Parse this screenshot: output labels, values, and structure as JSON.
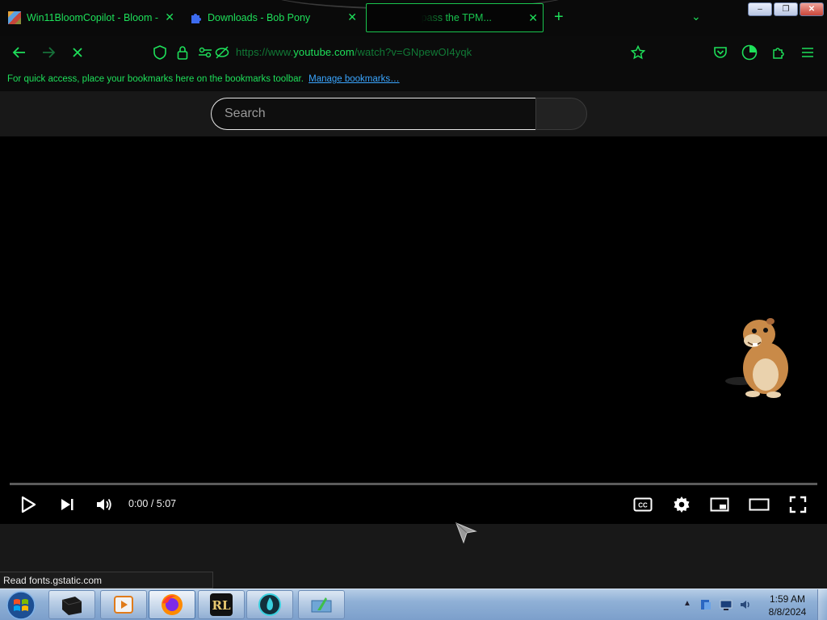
{
  "tabs": [
    {
      "title": "Win11BloomCopilot - Bloom -",
      "favicon": "bloom-favicon"
    },
    {
      "title": "Downloads - Bob Pony",
      "favicon": "puzzle-favicon"
    },
    {
      "title": "How to bypass the TPM...",
      "favicon": "youtube-favicon",
      "active": true
    }
  ],
  "window_controls": {
    "minimize": "‒",
    "restore": "❐",
    "close": "✕"
  },
  "url": {
    "scheme": "https://www.",
    "host": "youtube.com",
    "path": "/watch?v=GNpewOI4yqk"
  },
  "bookmarks_bar": {
    "message": "For quick access, place your bookmarks here on the bookmarks toolbar.",
    "link": "Manage bookmarks…"
  },
  "youtube": {
    "search_placeholder": "Search"
  },
  "player": {
    "current_time": "0:00",
    "duration": "5:07",
    "time_display": "0:00 / 5:07",
    "progress_fraction": 0.0
  },
  "status_text": "Read fonts.gstatic.com",
  "taskbar": {
    "clock_time": "1:59 AM",
    "clock_date": "8/8/2024",
    "apps": [
      "terminal",
      "media-player",
      "firefox",
      "rl-app",
      "flame-app",
      "explorer-app"
    ]
  },
  "colors": {
    "accent": "#1ee05a",
    "link": "#3aa6ff",
    "progress": "#ff0000"
  }
}
